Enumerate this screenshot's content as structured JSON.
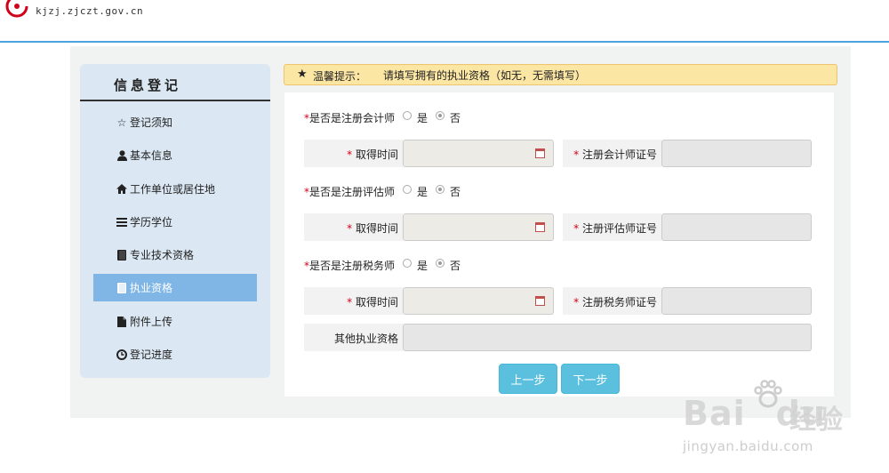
{
  "header": {
    "site_url": "kjzj.zjczt.gov.cn"
  },
  "sidebar": {
    "title": "信息登记",
    "items": [
      {
        "label": "登记须知",
        "icon": "star-outline-icon",
        "glyph": "☆",
        "active": false
      },
      {
        "label": "基本信息",
        "icon": "user-icon",
        "glyph": "👤",
        "active": false
      },
      {
        "label": "工作单位或居住地",
        "icon": "home-icon",
        "glyph": "⌂",
        "active": false
      },
      {
        "label": "学历学位",
        "icon": "list-icon",
        "glyph": "≡",
        "active": false
      },
      {
        "label": "专业技术资格",
        "icon": "book-icon",
        "glyph": "▮",
        "active": false
      },
      {
        "label": "执业资格",
        "icon": "book-icon",
        "glyph": "▮",
        "active": true
      },
      {
        "label": "附件上传",
        "icon": "file-icon",
        "glyph": "▙",
        "active": false
      },
      {
        "label": "登记进度",
        "icon": "clock-icon",
        "glyph": "◷",
        "active": false
      }
    ]
  },
  "tip": {
    "label": "温馨提示：",
    "text": "请填写拥有的执业资格（如无，无需填写）"
  },
  "form": {
    "sections": [
      {
        "question": "是否是注册会计师",
        "yes": "是",
        "no": "否",
        "selected": "否",
        "date_label": "取得时间",
        "cert_label": "注册会计师证号",
        "date_value": "",
        "cert_value": ""
      },
      {
        "question": "是否是注册评估师",
        "yes": "是",
        "no": "否",
        "selected": "否",
        "date_label": "取得时间",
        "cert_label": "注册评估师证号",
        "date_value": "",
        "cert_value": ""
      },
      {
        "question": "是否是注册税务师",
        "yes": "是",
        "no": "否",
        "selected": "否",
        "date_label": "取得时间",
        "cert_label": "注册税务师证号",
        "date_value": "",
        "cert_value": ""
      }
    ],
    "other_label": "其他执业资格",
    "other_value": "",
    "required_mark": "*"
  },
  "buttons": {
    "prev": "上一步",
    "next": "下一步"
  },
  "watermark": {
    "brand": "Bai",
    "brand2": "du",
    "cn": "经验",
    "url": "jingyan.baidu.com"
  },
  "colors": {
    "accent": "#4aa3df",
    "active_nav": "#7fb6e6",
    "button": "#5bc0de",
    "tip_bg": "#fce6a4",
    "required": "#d0021b"
  }
}
